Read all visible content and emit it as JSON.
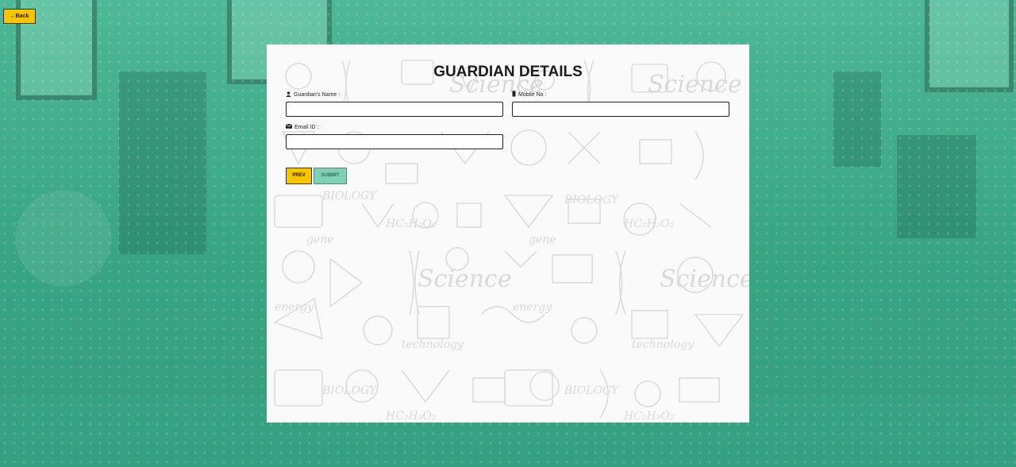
{
  "back_button": {
    "label": "←Back"
  },
  "form": {
    "title": "GUARDIAN DETAILS",
    "guardian_name": {
      "label": "Guardian's Name :",
      "value": "",
      "placeholder": ""
    },
    "mobile_no": {
      "label": "Mobile No :",
      "value": "",
      "placeholder": ""
    },
    "email_id": {
      "label": "Email ID :",
      "value": "",
      "placeholder": ""
    },
    "prev_label": "PREV",
    "submit_label": "SUBMIT"
  },
  "icons": {
    "guardian_name": "user-icon",
    "mobile_no": "mobile-icon",
    "email_id": "envelope-icon"
  },
  "colors": {
    "accent_yellow": "#f7c400",
    "submit_green": "#7fd0b4",
    "background_teal": "#3fae8c"
  }
}
